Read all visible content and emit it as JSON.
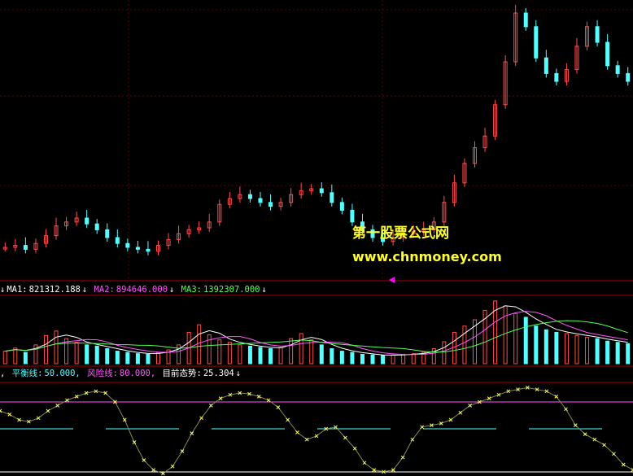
{
  "colors": {
    "up": "#ff4d4d",
    "down": "#55ffff",
    "ma1": "#ffffff",
    "ma2": "#ff55ff",
    "ma3": "#55ff55",
    "separator": "#aa0000",
    "balance": "#55ffff",
    "risk": "#ff55ff",
    "trend": "#ffff66",
    "watermark": "#ffff33"
  },
  "volume_header": {
    "ma1_label": "MA1:",
    "ma1_value": "821312.188",
    "ma2_label": "MA2:",
    "ma2_value": "894646.000",
    "ma3_label": "MA3:",
    "ma3_value": "1392307.000",
    "arrow": "↓"
  },
  "indicator_header": {
    "balance_label": "平衡线:",
    "balance_value": "50.000,",
    "risk_label": "风险线:",
    "risk_value": "80.000,",
    "trend_label": "目前态势:",
    "trend_value": "25.304",
    "arrow": "↓"
  },
  "watermark": {
    "title": "第一股票公式网",
    "url": "www.chnmoney.com"
  },
  "chart_data": {
    "type": "line",
    "panels": [
      "price-candlestick",
      "volume-bars-with-ma",
      "trend-oscillator"
    ],
    "indicator": {
      "balance_line": 50,
      "risk_line": 80,
      "current_trend": 25.304
    },
    "volume_ma": {
      "MA1": 821312.188,
      "MA2": 894646.0,
      "MA3": 1392307.0
    },
    "trend_series": [
      70,
      66,
      60,
      58,
      62,
      70,
      76,
      82,
      86,
      90,
      92,
      90,
      80,
      60,
      35,
      15,
      4,
      0,
      8,
      25,
      45,
      62,
      76,
      84,
      88,
      90,
      89,
      86,
      82,
      74,
      60,
      46,
      38,
      42,
      50,
      52,
      40,
      28,
      12,
      4,
      2,
      4,
      18,
      38,
      52,
      54,
      56,
      60,
      68,
      76,
      80,
      84,
      88,
      92,
      94,
      96,
      94,
      92,
      86,
      72,
      54,
      44,
      38,
      32,
      22,
      10,
      4
    ],
    "price_close": [
      15,
      16,
      14,
      17,
      21,
      26,
      28,
      30,
      27,
      24,
      20,
      17,
      15,
      14,
      13,
      16,
      19,
      22,
      24,
      25,
      28,
      37,
      40,
      42,
      40,
      38,
      36,
      38,
      42,
      44,
      45,
      43,
      38,
      34,
      28,
      24,
      20,
      18,
      20,
      22,
      23,
      24,
      28,
      38,
      48,
      58,
      66,
      72,
      88,
      110,
      135,
      128,
      112,
      104,
      100,
      106,
      118,
      128,
      120,
      108,
      104,
      100
    ],
    "volume": [
      20,
      25,
      18,
      30,
      45,
      52,
      40,
      34,
      30,
      28,
      24,
      20,
      18,
      16,
      15,
      18,
      22,
      30,
      50,
      62,
      46,
      38,
      34,
      30,
      28,
      26,
      24,
      26,
      40,
      48,
      38,
      30,
      24,
      20,
      18,
      15,
      14,
      13,
      14,
      15,
      16,
      18,
      24,
      35,
      50,
      60,
      70,
      85,
      100,
      92,
      80,
      74,
      60,
      54,
      50,
      48,
      45,
      42,
      40,
      36,
      34,
      32
    ]
  }
}
